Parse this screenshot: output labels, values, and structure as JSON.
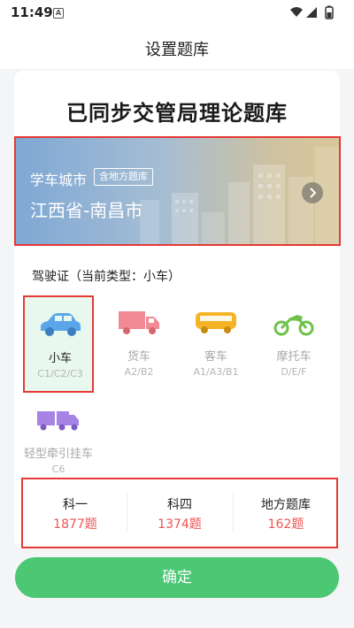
{
  "status": {
    "time": "11:49",
    "notif_icon": "A"
  },
  "nav": {
    "title": "设置题库"
  },
  "headline": "已同步交管局理论题库",
  "banner": {
    "label": "学车城市",
    "tag": "含地方题库",
    "city": "江西省-南昌市"
  },
  "license": {
    "title": "驾驶证（当前类型：小车）"
  },
  "vehicles": [
    {
      "name": "小车",
      "code": "C1/C2/C3",
      "icon": "car-icon",
      "selected": true,
      "color": "#5aa6e8"
    },
    {
      "name": "货车",
      "code": "A2/B2",
      "icon": "truck-icon",
      "selected": false,
      "color": "#f08a93"
    },
    {
      "name": "客车",
      "code": "A1/A3/B1",
      "icon": "bus-icon",
      "selected": false,
      "color": "#f5b325"
    },
    {
      "name": "摩托车",
      "code": "D/E/F",
      "icon": "motorcycle-icon",
      "selected": false,
      "color": "#6cc24a"
    },
    {
      "name": "轻型牵引挂车",
      "code": "C6",
      "icon": "trailer-icon",
      "selected": false,
      "color": "#a883e6"
    }
  ],
  "stats": [
    {
      "name": "科一",
      "count": "1877题"
    },
    {
      "name": "科四",
      "count": "1374题"
    },
    {
      "name": "地方题库",
      "count": "162题"
    }
  ],
  "confirm_label": "确定",
  "colors": {
    "accent_green": "#4cc774",
    "count_red": "#ef5350",
    "highlight_red": "#e53935"
  }
}
